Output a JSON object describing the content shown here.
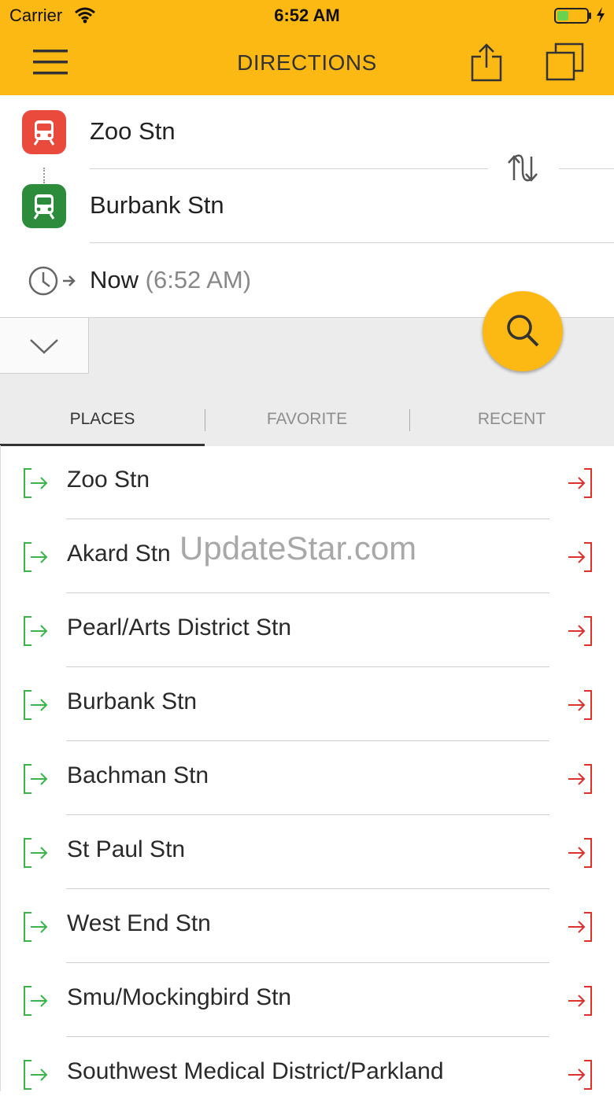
{
  "status_bar": {
    "carrier": "Carrier",
    "time": "6:52 AM",
    "battery_color": "#6cd14c"
  },
  "nav": {
    "title": "DIRECTIONS",
    "bar_color": "#fdb913"
  },
  "route": {
    "origin": "Zoo Stn",
    "destination": "Burbank Stn",
    "time_main": "Now",
    "time_sub": "(6:52 AM)",
    "origin_color": "#ea4a3c",
    "destination_color": "#2c8c3c"
  },
  "tabs": [
    {
      "label": "PLACES",
      "active": true
    },
    {
      "label": "FAVORITE",
      "active": false
    },
    {
      "label": "RECENT",
      "active": false
    }
  ],
  "places": [
    "Zoo Stn",
    "Akard Stn",
    "Pearl/Arts District Stn",
    "Burbank Stn",
    "Bachman Stn",
    "St Paul Stn",
    "West End Stn",
    "Smu/Mockingbird Stn",
    "Southwest Medical District/Parkland"
  ],
  "watermark": "UpdateStar.com",
  "icons": {
    "menu": "hamburger-icon",
    "share": "share-icon",
    "copy": "copy-icon",
    "swap": "swap-icon",
    "clock": "clock-icon",
    "expand": "chevron-down-icon",
    "search": "search-icon",
    "from": "set-origin-icon",
    "to": "set-destination-icon"
  }
}
